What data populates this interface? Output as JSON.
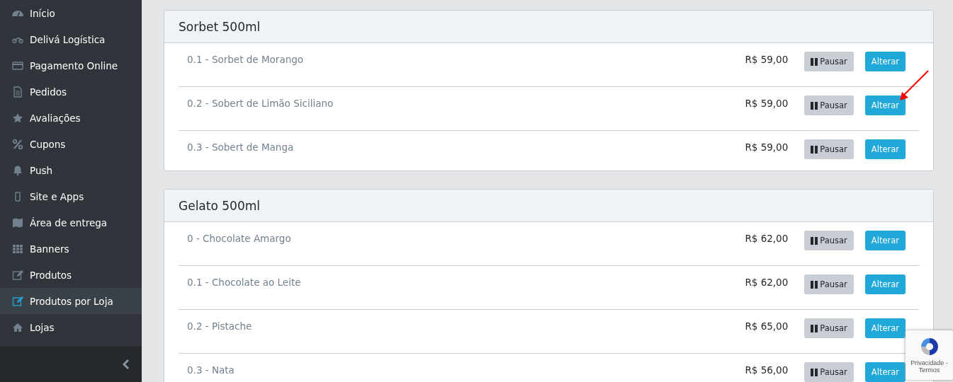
{
  "sidebar": {
    "items": [
      {
        "label": "Início",
        "selected": false
      },
      {
        "label": "Delivá Logística",
        "selected": false
      },
      {
        "label": "Pagamento Online",
        "selected": false
      },
      {
        "label": "Pedidos",
        "selected": false
      },
      {
        "label": "Avaliações",
        "selected": false
      },
      {
        "label": "Cupons",
        "selected": false
      },
      {
        "label": "Push",
        "selected": false
      },
      {
        "label": "Site e Apps",
        "selected": false
      },
      {
        "label": "Área de entrega",
        "selected": false
      },
      {
        "label": "Banners",
        "selected": false
      },
      {
        "label": "Produtos",
        "selected": false
      },
      {
        "label": "Produtos por Loja",
        "selected": true
      },
      {
        "label": "Lojas",
        "selected": false
      }
    ]
  },
  "categories": [
    {
      "title": "Sorbet 500ml",
      "products": [
        {
          "name": "0.1 - Sorbet de Morango",
          "price": "R$ 59,00",
          "pause_label": "Pausar",
          "edit_label": "Alterar"
        },
        {
          "name": "0.2 - Sobert de Limão Siciliano",
          "price": "R$ 59,00",
          "pause_label": "Pausar",
          "edit_label": "Alterar"
        },
        {
          "name": "0.3 - Sobert de Manga",
          "price": "R$ 59,00",
          "pause_label": "Pausar",
          "edit_label": "Alterar"
        }
      ]
    },
    {
      "title": "Gelato 500ml",
      "products": [
        {
          "name": "0 - Chocolate Amargo",
          "price": "R$ 62,00",
          "pause_label": "Pausar",
          "edit_label": "Alterar"
        },
        {
          "name": "0.1 - Chocolate ao Leite",
          "price": "R$ 62,00",
          "pause_label": "Pausar",
          "edit_label": "Alterar"
        },
        {
          "name": "0.2 - Pistache",
          "price": "R$ 65,00",
          "pause_label": "Pausar",
          "edit_label": "Alterar"
        },
        {
          "name": "0.3 - Nata",
          "price": "R$ 56,00",
          "pause_label": "Pausar",
          "edit_label": "Alterar"
        }
      ]
    }
  ],
  "captcha_badge": {
    "links": "Privacidade - Termos"
  }
}
